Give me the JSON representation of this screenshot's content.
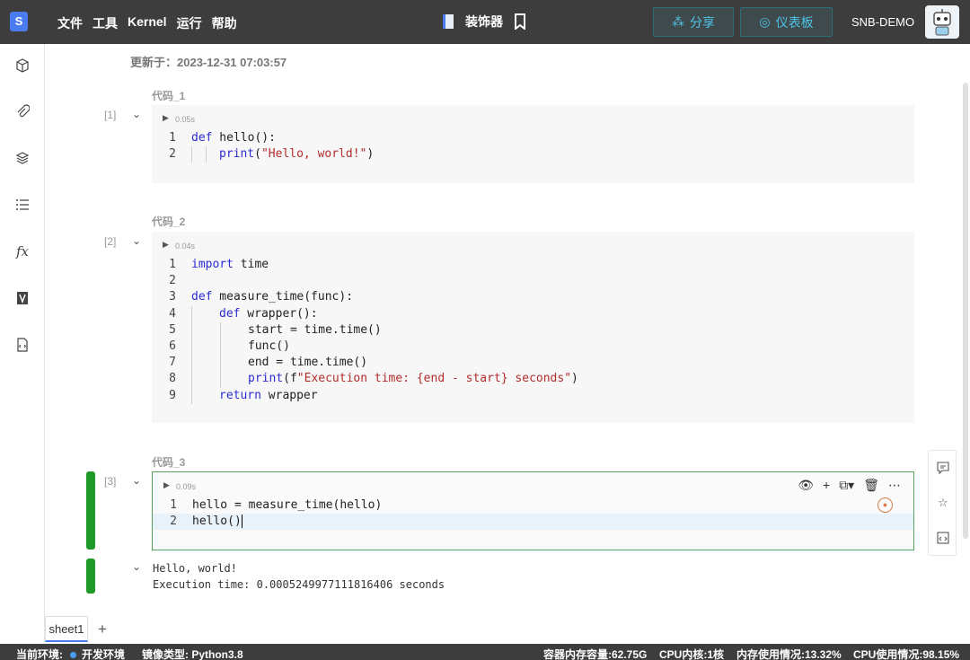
{
  "topbar": {
    "logo": "S",
    "menu": [
      "文件",
      "工具",
      "Kernel",
      "运行",
      "帮助"
    ],
    "doc_title": "装饰器",
    "share_label": "分享",
    "dashboard_label": "仪表板",
    "user_name": "SNB-DEMO"
  },
  "notebook": {
    "updated": "更新于：2023-12-31 07:03:57",
    "cells": [
      {
        "label": "代码_1",
        "exec_count": "[1]",
        "time": "0.05s",
        "lines": [
          {
            "n": "1"
          },
          {
            "n": "2"
          }
        ]
      },
      {
        "label": "代码_2",
        "exec_count": "[2]",
        "time": "0.04s",
        "lines": [
          {
            "n": "1"
          },
          {
            "n": "2"
          },
          {
            "n": "3"
          },
          {
            "n": "4"
          },
          {
            "n": "5"
          },
          {
            "n": "6"
          },
          {
            "n": "7"
          },
          {
            "n": "8"
          },
          {
            "n": "9"
          }
        ]
      },
      {
        "label": "代码_3",
        "exec_count": "[3]",
        "time": "0.09s",
        "lines": [
          {
            "n": "1",
            "code": "hello = measure_time(hello)"
          },
          {
            "n": "2",
            "code": "hello()"
          }
        ]
      }
    ],
    "code1": {
      "l1_kw": "def",
      "l1_rest": " hello():",
      "l2_kw": "print",
      "l2_open": "(",
      "l2_str": "\"Hello, world!\"",
      "l2_close": ")"
    },
    "code2": {
      "l1_kw": "import",
      "l1_rest": " time",
      "l3_kw": "def",
      "l3_rest": " measure_time(func):",
      "l4_kw": "def",
      "l4_rest": " wrapper():",
      "l5": "start = time.time()",
      "l6": "func()",
      "l7": "end = time.time()",
      "l8_kw": "print",
      "l8_open": "(f",
      "l8_str": "\"Execution time: {end - start} seconds\"",
      "l8_close": ")",
      "l9_kw": "return",
      "l9_rest": " wrapper"
    },
    "output": "Hello, world!\nExecution time: 0.0005249977111816406 seconds"
  },
  "sheets": {
    "tab": "sheet1",
    "add": "+"
  },
  "status": {
    "env_label": "当前环境:",
    "env_value": "开发环境",
    "image_type": "镜像类型:  Python3.8",
    "container_mem": "容器内存容量:62.75G",
    "cpu_cores": "CPU内核:1核",
    "mem_usage": "内存使用情况:13.32%",
    "cpu_usage": "CPU使用情况:98.15%"
  },
  "colors": {
    "topbar": "#3d3d3d",
    "accent": "#4fc3e8",
    "active_cell": "#55a35a",
    "green_bar": "#1f9a29"
  }
}
